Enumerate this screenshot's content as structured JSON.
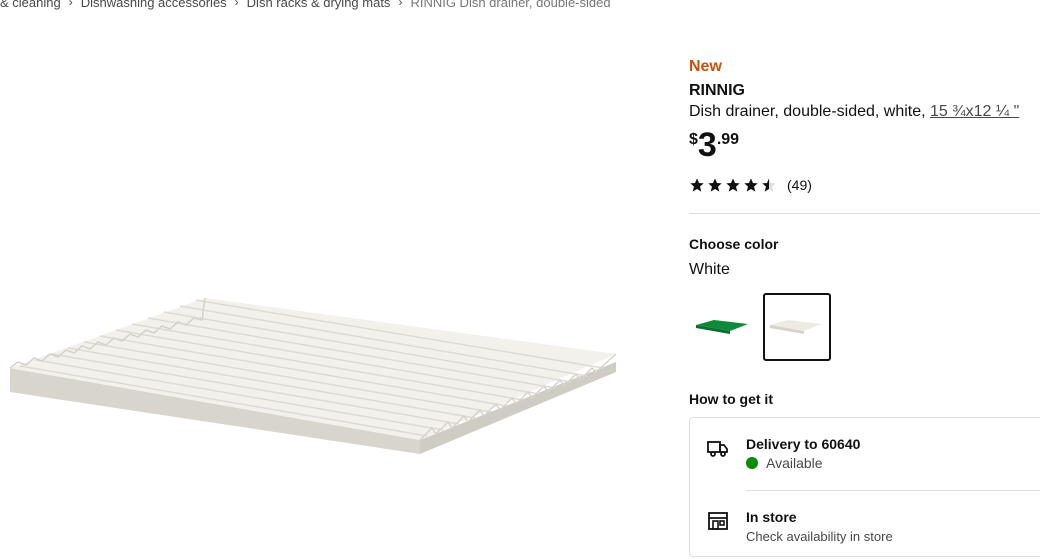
{
  "breadcrumb": {
    "items": [
      "& cleaning",
      "Dishwashing accessories",
      "Dish racks & drying mats"
    ],
    "current": "RINNIG Dish drainer, double-sided",
    "separator": "›"
  },
  "product": {
    "badge": "New",
    "name": "RINNIG",
    "description": "Dish drainer, double-sided, white,",
    "measurement": "15 ¾x12 ¼ \"",
    "price": {
      "currency": "$",
      "integer": "3",
      "decimal": ".99"
    },
    "rating": {
      "value": 4.5,
      "max": 5,
      "count_label": "(49)"
    }
  },
  "color": {
    "heading": "Choose color",
    "selected": "White",
    "options": [
      {
        "name": "green-variant",
        "color": "#0e8a3a"
      },
      {
        "name": "white-variant",
        "color": "#ecebe4"
      }
    ]
  },
  "fulfillment": {
    "heading": "How to get it",
    "delivery_title": "Delivery to 60640",
    "delivery_status": "Available",
    "store_title": "In store",
    "store_subtitle": "Check availability in store",
    "status_color": "#0a8a00"
  },
  "colors": {
    "badge": "#ca5008",
    "divider": "#dfdfdf",
    "text": "#111111"
  }
}
